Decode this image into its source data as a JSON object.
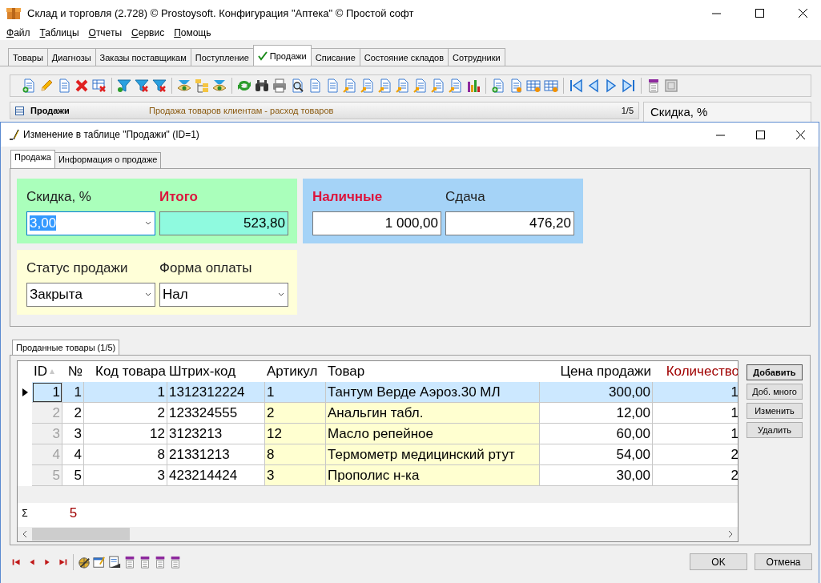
{
  "window": {
    "title": "Склад и торговля (2.728) © Prostoysoft. Конфигурация \"Аптека\" © Простой софт"
  },
  "menu": [
    {
      "label": "Файл"
    },
    {
      "label": "Таблицы"
    },
    {
      "label": "Отчеты"
    },
    {
      "label": "Сервис"
    },
    {
      "label": "Помощь"
    }
  ],
  "tabs": [
    {
      "label": "Товары",
      "selected": false
    },
    {
      "label": "Диагнозы",
      "selected": false
    },
    {
      "label": "Заказы поставщикам",
      "selected": false
    },
    {
      "label": "Поступление",
      "selected": false
    },
    {
      "label": "Продажи",
      "selected": true
    },
    {
      "label": "Списание",
      "selected": false
    },
    {
      "label": "Состояние складов",
      "selected": false
    },
    {
      "label": "Сотрудники",
      "selected": false
    }
  ],
  "list_header": {
    "title": "Продажи",
    "description": "Продажа товаров клиентам - расход товаров",
    "count": "1/5"
  },
  "side_panel": {
    "label": "Скидка, %"
  },
  "dialog": {
    "title": "Изменение в таблице \"Продажи\" (ID=1)",
    "tabs": [
      {
        "label": "Продажа",
        "selected": true
      },
      {
        "label": "Информация о продаже",
        "selected": false
      }
    ],
    "panel_rows": [
      {
        "panels": [
          {
            "color": "#aaffbb",
            "fields": [
              {
                "label": "Скидка, %",
                "value": "3,00",
                "kind": "combo",
                "emphasis": false,
                "focused": true
              },
              {
                "label": "Итого",
                "value": "523,80",
                "kind": "total",
                "emphasis": true,
                "focused": false
              }
            ]
          },
          {
            "color": "#a5d3f7",
            "fields": [
              {
                "label": "Наличные",
                "value": "1 000,00",
                "kind": "input",
                "emphasis": true,
                "focused": false
              },
              {
                "label": "Сдача",
                "value": "476,20",
                "kind": "input",
                "emphasis": false,
                "focused": false
              }
            ]
          }
        ]
      },
      {
        "panels": [
          {
            "color": "#ffffd8",
            "fields": [
              {
                "label": "Статус продажи",
                "value": "Закрыта",
                "kind": "combo",
                "emphasis": false,
                "focused": false
              },
              {
                "label": "Форма оплаты",
                "value": "Нал",
                "kind": "combo",
                "emphasis": false,
                "focused": false
              }
            ]
          }
        ]
      }
    ],
    "items_tab": {
      "label": "Проданные товары (1/5)",
      "selected": true
    },
    "grid": {
      "columns": [
        {
          "label": "ID",
          "kind": "id",
          "sorted": true,
          "required": false,
          "highlighted": false
        },
        {
          "label": "№",
          "kind": "num",
          "sorted": false,
          "required": false,
          "highlighted": false
        },
        {
          "label": "Код товара",
          "kind": "num",
          "sorted": false,
          "required": false,
          "highlighted": false
        },
        {
          "label": "Штрих-код",
          "kind": "text",
          "sorted": false,
          "required": false,
          "highlighted": false
        },
        {
          "label": "Артикул",
          "kind": "text",
          "sorted": false,
          "required": false,
          "highlighted": true
        },
        {
          "label": "Товар",
          "kind": "text",
          "sorted": false,
          "required": false,
          "highlighted": true
        },
        {
          "label": "Цена продажи",
          "kind": "num",
          "sorted": false,
          "required": false,
          "highlighted": false
        },
        {
          "label": "Количество",
          "kind": "num",
          "sorted": false,
          "required": true,
          "highlighted": false
        }
      ],
      "rows": [
        {
          "selected": true,
          "cells": [
            "1",
            "1",
            "1",
            "1312312224",
            "1",
            "Тантум Верде Аэроз.30 МЛ",
            "300,00",
            "1"
          ]
        },
        {
          "selected": false,
          "cells": [
            "2",
            "2",
            "2",
            "123324555",
            "2",
            "Анальгин табл.",
            "12,00",
            "1"
          ]
        },
        {
          "selected": false,
          "cells": [
            "3",
            "3",
            "12",
            "3123213",
            "12",
            "Масло репейное",
            "60,00",
            "1"
          ]
        },
        {
          "selected": false,
          "cells": [
            "4",
            "4",
            "8",
            "21331213",
            "8",
            "Термометр медицинский ртут",
            "54,00",
            "2"
          ]
        },
        {
          "selected": false,
          "cells": [
            "5",
            "5",
            "3",
            "423214424",
            "3",
            "Прополис н-ка",
            "30,00",
            "2"
          ]
        }
      ],
      "footer": {
        "symbol": "Σ",
        "count": "5"
      }
    },
    "grid_buttons": [
      {
        "label": "Добавить",
        "default": true
      },
      {
        "label": "Доб. много",
        "default": false
      },
      {
        "label": "Изменить",
        "default": false
      },
      {
        "label": "Удалить",
        "default": false
      }
    ],
    "buttons": [
      {
        "label": "OK"
      },
      {
        "label": "Отмена"
      }
    ]
  }
}
